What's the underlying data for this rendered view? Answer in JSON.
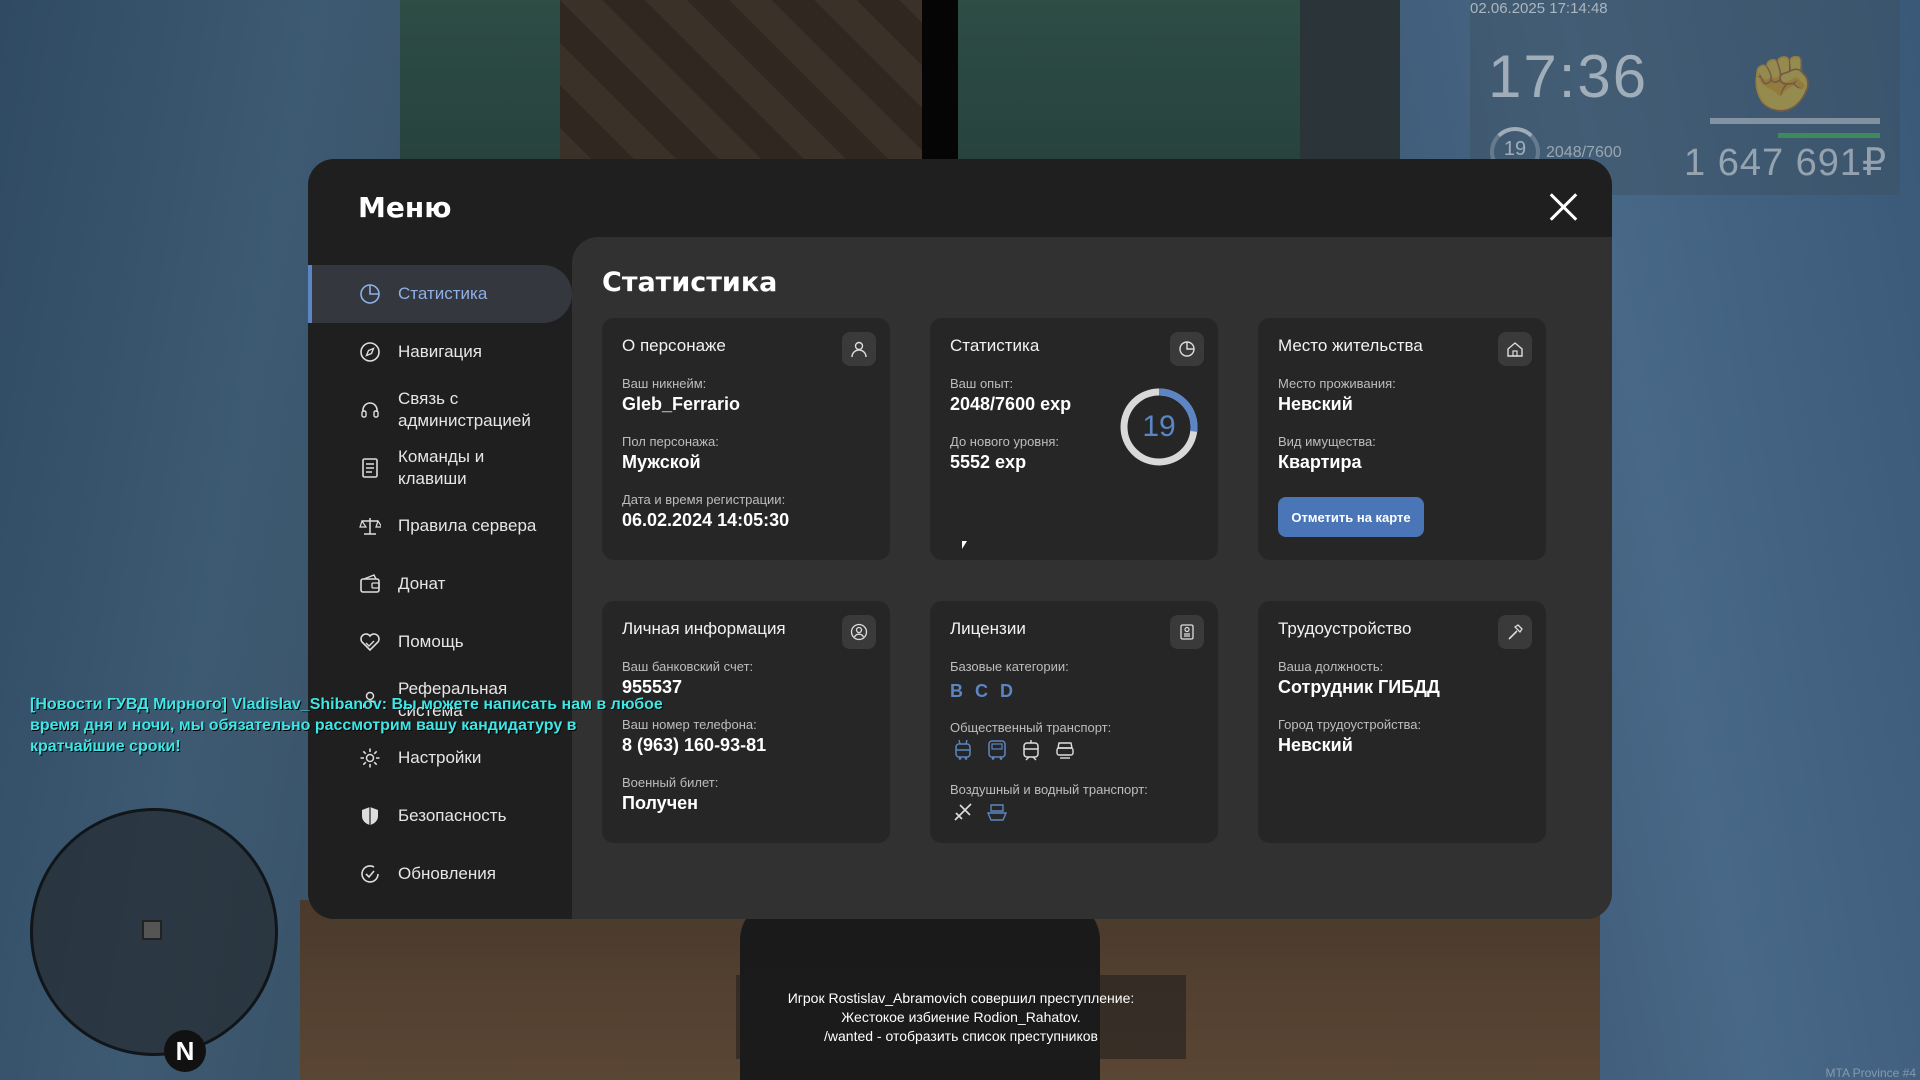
{
  "hud": {
    "datetime": "02.06.2025 17:14:48",
    "clock": "17:36",
    "level": "19",
    "exp": "2048/7600",
    "money": "1 647 691₽"
  },
  "menu": {
    "title": "Меню",
    "nav": [
      {
        "label": "Статистика",
        "icon": "pie-chart-icon",
        "active": true
      },
      {
        "label": "Навигация",
        "icon": "compass-icon"
      },
      {
        "label": "Связь с администрацией",
        "icon": "headset-icon"
      },
      {
        "label": "Команды и клавиши",
        "icon": "document-icon"
      },
      {
        "label": "Правила сервера",
        "icon": "scales-icon"
      },
      {
        "label": "Донат",
        "icon": "wallet-icon"
      },
      {
        "label": "Помощь",
        "icon": "handshake-heart-icon"
      },
      {
        "label": "Реферальная система",
        "icon": "referral-icon"
      },
      {
        "label": "Настройки",
        "icon": "gear-icon"
      },
      {
        "label": "Безопасность",
        "icon": "shield-icon"
      },
      {
        "label": "Обновления",
        "icon": "refresh-check-icon"
      }
    ]
  },
  "stats": {
    "title": "Статистика",
    "character": {
      "title": "О персонаже",
      "icon": "user-icon",
      "nickname_label": "Ваш никнейм:",
      "nickname": "Gleb_Ferrario",
      "gender_label": "Пол персонажа:",
      "gender": "Мужской",
      "reg_label": "Дата и время регистрации:",
      "reg_date": "06.02.2024 14:05:30"
    },
    "statistics": {
      "title": "Статистика",
      "icon": "chart-pie-icon",
      "exp_label": "Ваш опыт:",
      "exp": "2048/7600 exp",
      "next_label": "До нового уровня:",
      "next": "5552 exp",
      "level": "19",
      "progress": 0.27
    },
    "residence": {
      "title": "Место жительства",
      "icon": "house-icon",
      "place_label": "Место проживания:",
      "place": "Невский",
      "property_label": "Вид имущества:",
      "property": "Квартира",
      "button": "Отметить на карте"
    },
    "personal": {
      "title": "Личная информация",
      "icon": "user-circle-icon",
      "bank_label": "Ваш банковский счет:",
      "bank": "955537",
      "phone_label": "Ваш номер телефона:",
      "phone": "8 (963) 160-93-81",
      "military_label": "Военный билет:",
      "military": "Получен"
    },
    "licenses": {
      "title": "Лицензии",
      "icon": "license-card-icon",
      "base_label": "Базовые категории:",
      "categories": [
        "B",
        "C",
        "D"
      ],
      "public_label": "Общественный транспорт:",
      "public_icons": [
        "trolleybus-icon",
        "bus-icon",
        "tram-icon",
        "taxi-icon"
      ],
      "air_label": "Воздушный и водный транспорт:",
      "air_icons": [
        "plane-icon",
        "boat-icon"
      ]
    },
    "employment": {
      "title": "Трудоустройство",
      "icon": "hammer-icon",
      "position_label": "Ваша должность:",
      "position": "Сотрудник ГИБДД",
      "city_label": "Город трудоустройства:",
      "city": "Невский"
    }
  },
  "chat": {
    "message": "[Новости ГУВД Мирного] Vladislav_Shibanov: Вы можете написать нам в любое время дня и ночи, мы обязательно рассмотрим вашу кандидатуру в кратчайшие сроки!"
  },
  "notice": {
    "line1": "Игрок Rostislav_Abramovich совершил преступление:",
    "line2": "Жестокое избиение Rodion_Rahatov.",
    "line3": "/wanted - отобразить список преступников"
  },
  "minimap": {
    "north": "N"
  },
  "watermark": "MTA Province #4",
  "colors": {
    "accent": "#5b85c4",
    "button": "#4a76b8",
    "chat": "#3ee6e6"
  }
}
